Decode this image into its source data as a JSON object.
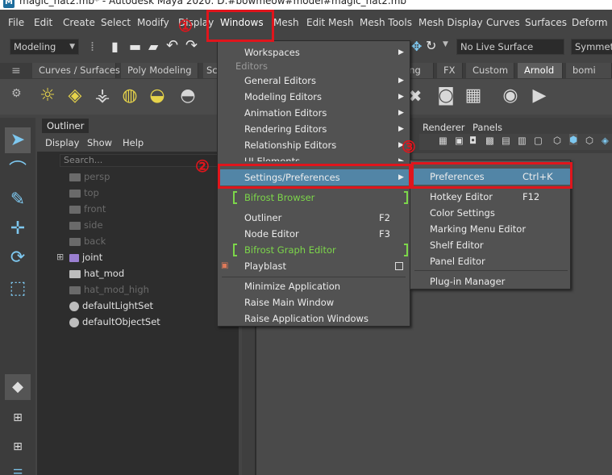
{
  "window": {
    "title": "magic_hat2.mb* - Autodesk Maya 2020: D:#bowmeow#model#magic_hat2.mb",
    "app_icon_glyph": "M"
  },
  "menubar": [
    "File",
    "Edit",
    "Create",
    "Select",
    "Modify",
    "Display",
    "Windows",
    "Mesh",
    "Edit Mesh",
    "Mesh Tools",
    "Mesh Display",
    "Curves",
    "Surfaces",
    "Deform"
  ],
  "statusline": {
    "mode": "Modeling",
    "live_surface": "No Live Surface",
    "symmetry": "Symmetry"
  },
  "shelf_tabs": [
    "Curves / Surfaces",
    "Poly Modeling",
    "Sc",
    "ing",
    "FX",
    "Custom",
    "Arnold",
    "bomi"
  ],
  "shelf_icons": [
    "sun-light-icon",
    "box-light-icon",
    "spot-light-icon",
    "sphere-light-icon",
    "half-sun-light-icon"
  ],
  "outliner": {
    "tab_label": "Outliner",
    "menu": [
      "Display",
      "Show",
      "Help"
    ],
    "search_placeholder": "Search...",
    "rows": [
      {
        "label": "persp",
        "bright": false
      },
      {
        "label": "top",
        "bright": false
      },
      {
        "label": "front",
        "bright": false
      },
      {
        "label": "side",
        "bright": false
      },
      {
        "label": "back",
        "bright": false
      },
      {
        "label": "joint",
        "bright": true
      },
      {
        "label": "hat_mod",
        "bright": true
      },
      {
        "label": "hat_mod_high",
        "bright": false
      },
      {
        "label": "defaultLightSet",
        "bright": true
      },
      {
        "label": "defaultObjectSet",
        "bright": true
      }
    ]
  },
  "viewport": {
    "panel_menu": [
      "Renderer",
      "Panels"
    ]
  },
  "windows_menu": {
    "items": [
      {
        "label": "Workspaces",
        "submenu": true
      },
      {
        "section": "Editors"
      },
      {
        "label": "General Editors",
        "submenu": true
      },
      {
        "label": "Modeling Editors",
        "submenu": true
      },
      {
        "label": "Animation Editors",
        "submenu": true
      },
      {
        "label": "Rendering Editors",
        "submenu": true
      },
      {
        "label": "Relationship Editors",
        "submenu": true
      },
      {
        "label": "UI Elements",
        "submenu": true
      },
      {
        "label": "Settings/Preferences",
        "submenu": true,
        "highlight": true
      },
      {
        "label": "Bifrost Browser",
        "green": true
      },
      {
        "label": "Outliner",
        "shortcut": "F2"
      },
      {
        "label": "Node Editor",
        "shortcut": "F3"
      },
      {
        "label": "Bifrost Graph Editor",
        "green": true
      },
      {
        "label": "Playblast",
        "option_box": true
      },
      {
        "label": "Minimize Application"
      },
      {
        "label": "Raise Main Window"
      },
      {
        "label": "Raise Application Windows"
      }
    ]
  },
  "settings_submenu": {
    "items": [
      {
        "label": "Preferences",
        "shortcut": "Ctrl+K",
        "highlight": true
      },
      {
        "label": "Hotkey Editor",
        "shortcut": "F12"
      },
      {
        "label": "Color Settings"
      },
      {
        "label": "Marking Menu Editor"
      },
      {
        "label": "Shelf Editor"
      },
      {
        "label": "Panel Editor"
      },
      {
        "label": "Plug-in Manager"
      }
    ]
  },
  "annotations": {
    "step1": "①",
    "step2": "②",
    "step3": "③",
    "color": "#e0151c"
  },
  "colors": {
    "highlight": "#5285a6",
    "green_item": "#7cd64a"
  }
}
